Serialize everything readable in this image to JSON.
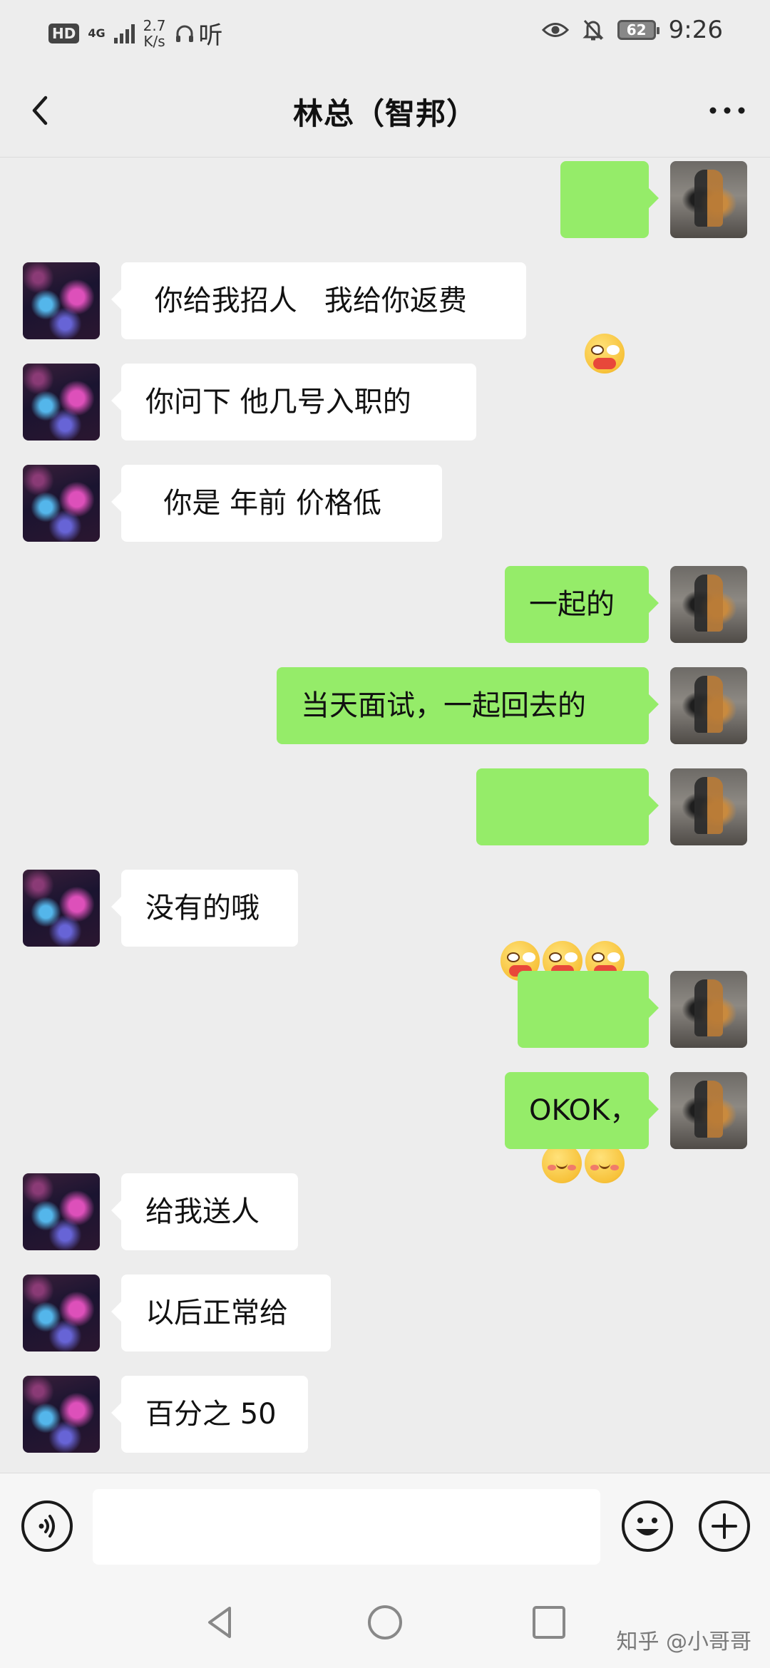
{
  "status_bar": {
    "hd": "HD",
    "network": "4G",
    "speed_value": "2.7",
    "speed_unit": "K/s",
    "listen_app": "听",
    "battery": "62",
    "time": "9:26"
  },
  "header": {
    "title": "林总（智邦）"
  },
  "messages": [
    {
      "sender": "self",
      "emoji": [
        "shy-face"
      ]
    },
    {
      "sender": "other",
      "text": " 你给我招人   我给你返费"
    },
    {
      "sender": "other",
      "text": "你问下 他几号入职的"
    },
    {
      "sender": "other",
      "text": "  你是 年前 价格低"
    },
    {
      "sender": "self",
      "text": "一起的"
    },
    {
      "sender": "self",
      "text": "当天面试，一起回去的"
    },
    {
      "sender": "self",
      "emoji": [
        "shy-face",
        "shy-face",
        "shy-face"
      ]
    },
    {
      "sender": "other",
      "text": "没有的哦"
    },
    {
      "sender": "self",
      "emoji": [
        "blush-face",
        "blush-face"
      ]
    },
    {
      "sender": "self",
      "text": "OKOK，"
    },
    {
      "sender": "other",
      "text": "给我送人"
    },
    {
      "sender": "other",
      "text": "以后正常给"
    },
    {
      "sender": "other",
      "text": "百分之 50"
    }
  ],
  "input_bar": {
    "placeholder": "",
    "icons": [
      "voice-icon",
      "emoji-icon",
      "plus-icon"
    ]
  },
  "nav_bar": {
    "icons": [
      "back-triangle-icon",
      "home-circle-icon",
      "recents-square-icon"
    ]
  },
  "watermark": "知乎 @小哥哥",
  "colors": {
    "background": "#ededed",
    "self_bubble": "#95ec69",
    "other_bubble": "#ffffff"
  }
}
